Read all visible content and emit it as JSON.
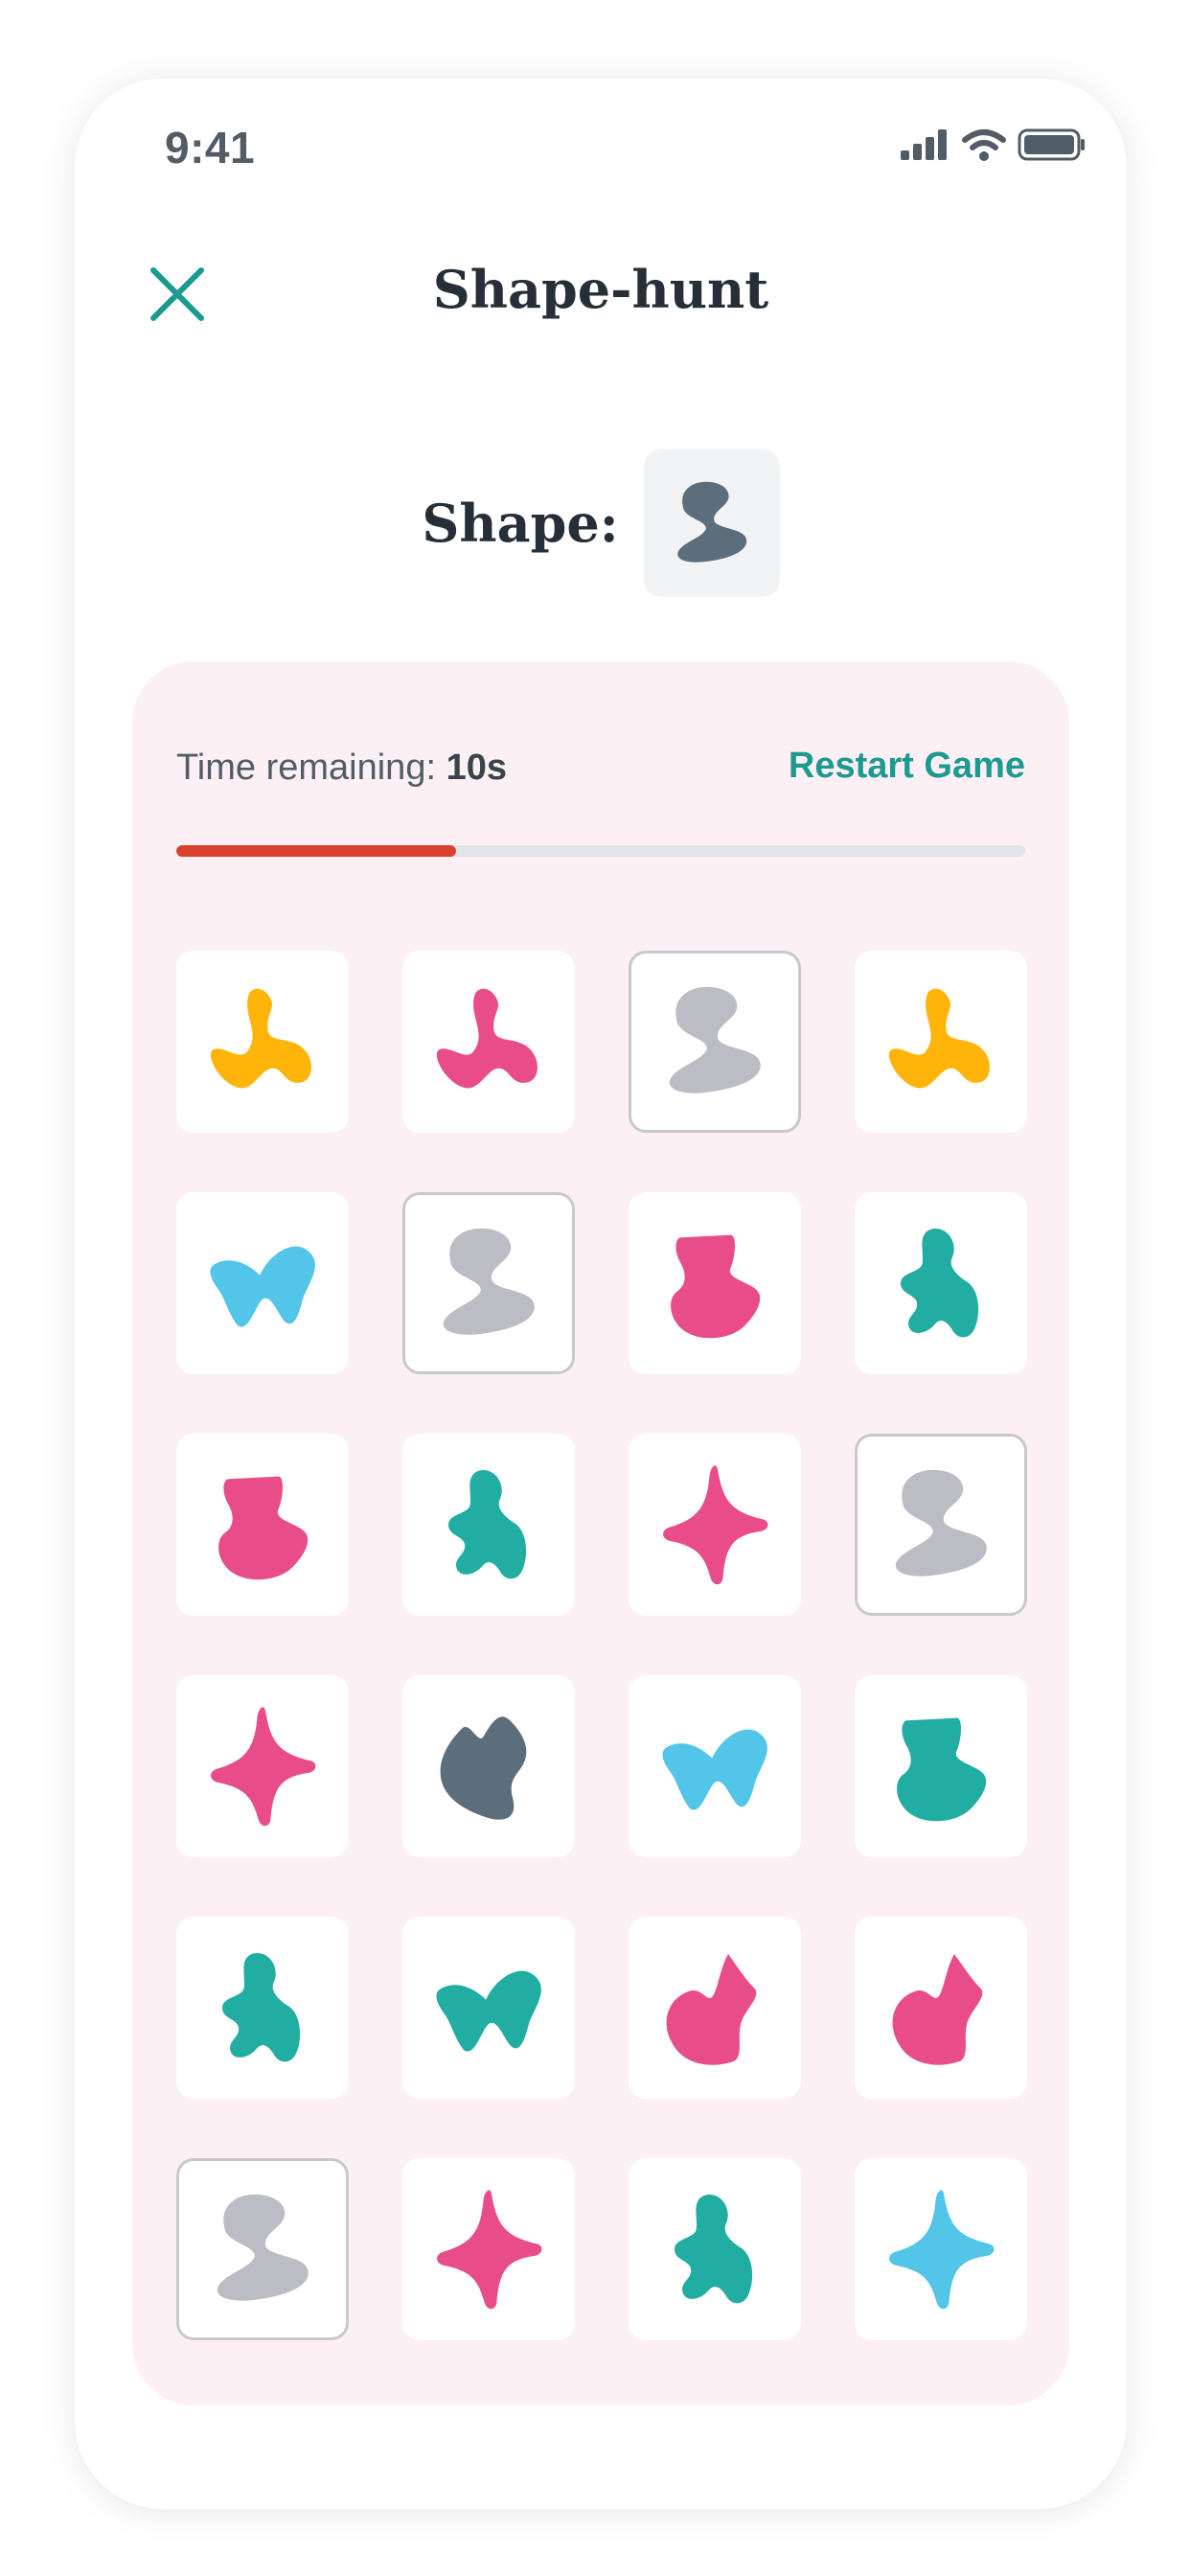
{
  "status": {
    "time": "9:41"
  },
  "header": {
    "title": "Shape-hunt"
  },
  "target": {
    "label": "Shape:",
    "shape": "s-blob",
    "color": "#5c6d7b"
  },
  "game": {
    "time_label": "Time remaining:",
    "time_value": "10s",
    "restart_label": "Restart Game",
    "progress": 0.33
  },
  "colors": {
    "accent": "#1c9a8f",
    "progress": "#d9402e",
    "panel": "#fcf0f5",
    "found": "#bbbcc4"
  },
  "tiles": [
    {
      "shape": "splash",
      "color": "#ffb40a",
      "found": false
    },
    {
      "shape": "splash",
      "color": "#e84d8a",
      "found": false
    },
    {
      "shape": "s-blob",
      "color": "#bbbcc4",
      "found": true
    },
    {
      "shape": "splash",
      "color": "#ffb40a",
      "found": false
    },
    {
      "shape": "fish",
      "color": "#52c5e8",
      "found": false
    },
    {
      "shape": "s-blob",
      "color": "#bbbcc4",
      "found": true
    },
    {
      "shape": "boot",
      "color": "#e84d8a",
      "found": false
    },
    {
      "shape": "clover",
      "color": "#22ada2",
      "found": false
    },
    {
      "shape": "boot",
      "color": "#e84d8a",
      "found": false
    },
    {
      "shape": "clover",
      "color": "#22ada2",
      "found": false
    },
    {
      "shape": "star",
      "color": "#e84d8a",
      "found": false
    },
    {
      "shape": "s-blob",
      "color": "#bbbcc4",
      "found": true
    },
    {
      "shape": "star",
      "color": "#e84d8a",
      "found": false
    },
    {
      "shape": "crown",
      "color": "#5c6d7b",
      "found": false
    },
    {
      "shape": "fish",
      "color": "#52c5e8",
      "found": false
    },
    {
      "shape": "boot",
      "color": "#22ada2",
      "found": false
    },
    {
      "shape": "clover",
      "color": "#22ada2",
      "found": false
    },
    {
      "shape": "fish",
      "color": "#22ada2",
      "found": false
    },
    {
      "shape": "flame",
      "color": "#e84d8a",
      "found": false
    },
    {
      "shape": "flame",
      "color": "#e84d8a",
      "found": false
    },
    {
      "shape": "s-blob",
      "color": "#bbbcc4",
      "found": true
    },
    {
      "shape": "star",
      "color": "#e84d8a",
      "found": false
    },
    {
      "shape": "clover",
      "color": "#22ada2",
      "found": false
    },
    {
      "shape": "star",
      "color": "#52c5e8",
      "found": false
    }
  ]
}
